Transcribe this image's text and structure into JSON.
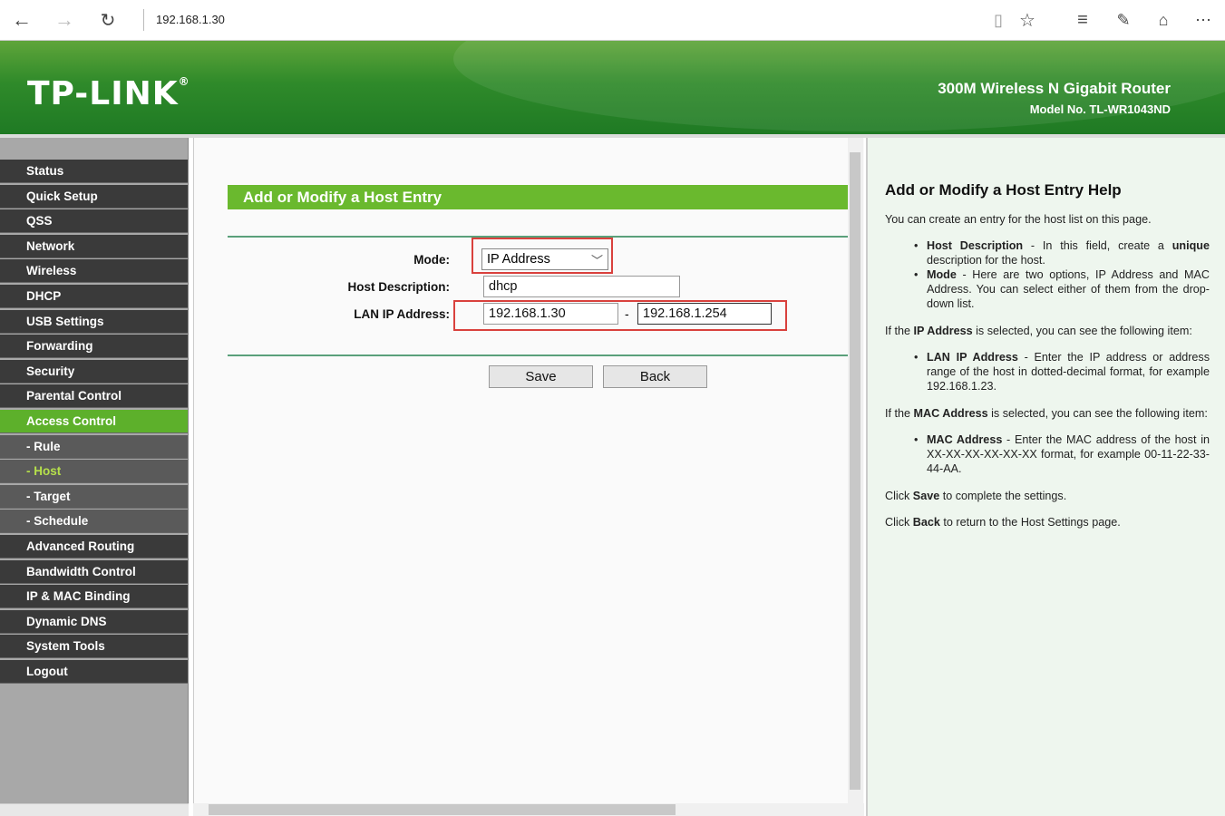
{
  "browser": {
    "url": "192.168.1.30"
  },
  "header": {
    "logo": "TP-LINK",
    "logo_reg": "®",
    "product": "300M Wireless N Gigabit Router",
    "model": "Model No. TL-WR1043ND"
  },
  "menu": [
    {
      "label": "Status"
    },
    {
      "label": "Quick Setup"
    },
    {
      "label": "QSS"
    },
    {
      "label": "Network"
    },
    {
      "label": "Wireless"
    },
    {
      "label": "DHCP"
    },
    {
      "label": "USB Settings"
    },
    {
      "label": "Forwarding"
    },
    {
      "label": "Security"
    },
    {
      "label": "Parental Control"
    },
    {
      "label": "Access Control"
    },
    {
      "label": "- Rule"
    },
    {
      "label": "- Host"
    },
    {
      "label": "- Target"
    },
    {
      "label": "- Schedule"
    },
    {
      "label": "Advanced Routing"
    },
    {
      "label": "Bandwidth Control"
    },
    {
      "label": "IP & MAC Binding"
    },
    {
      "label": "Dynamic DNS"
    },
    {
      "label": "System Tools"
    },
    {
      "label": "Logout"
    }
  ],
  "form": {
    "title": "Add or Modify a Host Entry",
    "mode_label": "Mode:",
    "mode_value": "IP Address",
    "desc_label": "Host Description:",
    "desc_value": "dhcp",
    "lan_label": "LAN IP Address:",
    "ip_start": "192.168.1.30",
    "ip_sep": "-",
    "ip_end": "192.168.1.254",
    "save": "Save",
    "back": "Back"
  },
  "help": {
    "title": "Add or Modify a Host Entry Help",
    "intro": "You can create an entry for the host list on this page.",
    "b1_term": "Host Description",
    "b1_text_a": " - In this field, create a ",
    "b1_strong": "unique",
    "b1_text_b": " description for the host.",
    "b2_term": "Mode",
    "b2_text": " - Here are two options, IP Address and MAC Address. You can select either of them from the drop-down list.",
    "p_ip_a": "If the ",
    "p_ip_strong": "IP Address",
    "p_ip_b": " is selected, you can see the following item:",
    "b3_term": "LAN IP Address",
    "b3_text": " - Enter the IP address or address range of the host in dotted-decimal format, for example 192.168.1.23.",
    "p_mac_a": "If the ",
    "p_mac_strong": "MAC Address",
    "p_mac_b": " is selected, you can see the following item:",
    "b4_term": "MAC Address",
    "b4_text": " - Enter the MAC address of the host in XX-XX-XX-XX-XX-XX format, for example 00-11-22-33-44-AA.",
    "save_a": "Click ",
    "save_strong": "Save",
    "save_b": " to complete the settings.",
    "back_a": "Click ",
    "back_strong": "Back",
    "back_b": " to return to the Host Settings page."
  }
}
